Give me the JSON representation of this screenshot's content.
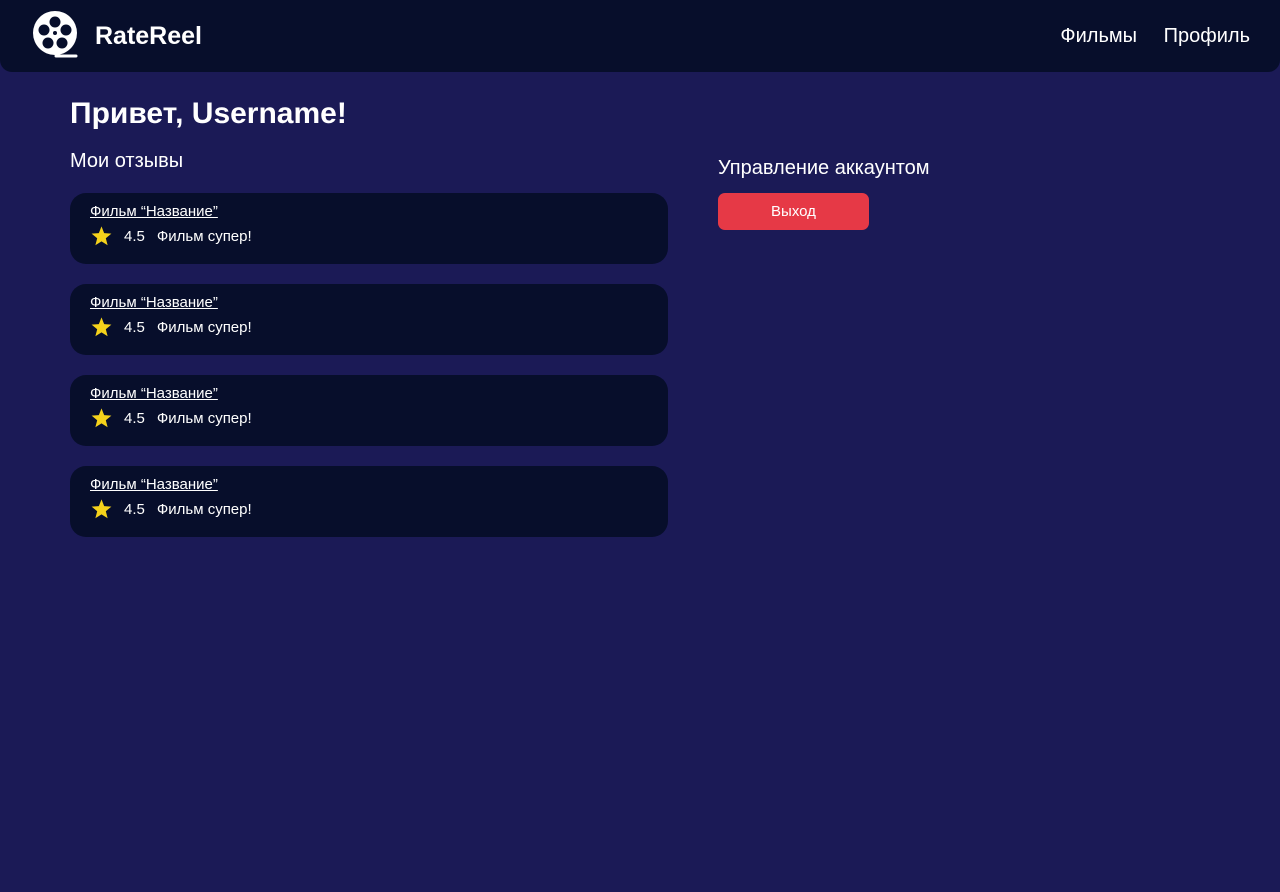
{
  "header": {
    "logo_icon": "film-reel-icon",
    "app_title": "RateReel",
    "nav": [
      {
        "label": "Фильмы"
      },
      {
        "label": "Профиль"
      }
    ]
  },
  "main": {
    "greeting": "Привет, Username!",
    "reviews_title": "Мои отзывы",
    "reviews": [
      {
        "film": "Фильм “Название”",
        "rating": "4.5",
        "text": "Фильм супер!"
      },
      {
        "film": "Фильм “Название”",
        "rating": "4.5",
        "text": "Фильм супер!"
      },
      {
        "film": "Фильм “Название”",
        "rating": "4.5",
        "text": "Фильм супер!"
      },
      {
        "film": "Фильм “Название”",
        "rating": "4.5",
        "text": "Фильм супер!"
      }
    ],
    "account": {
      "title": "Управление аккаунтом",
      "logout_label": "Выход"
    }
  },
  "colors": {
    "background": "#1b1a56",
    "header_bg": "#070e2b",
    "card_bg": "#070e2b",
    "accent_red": "#e63946",
    "star": "#f5d21b"
  }
}
